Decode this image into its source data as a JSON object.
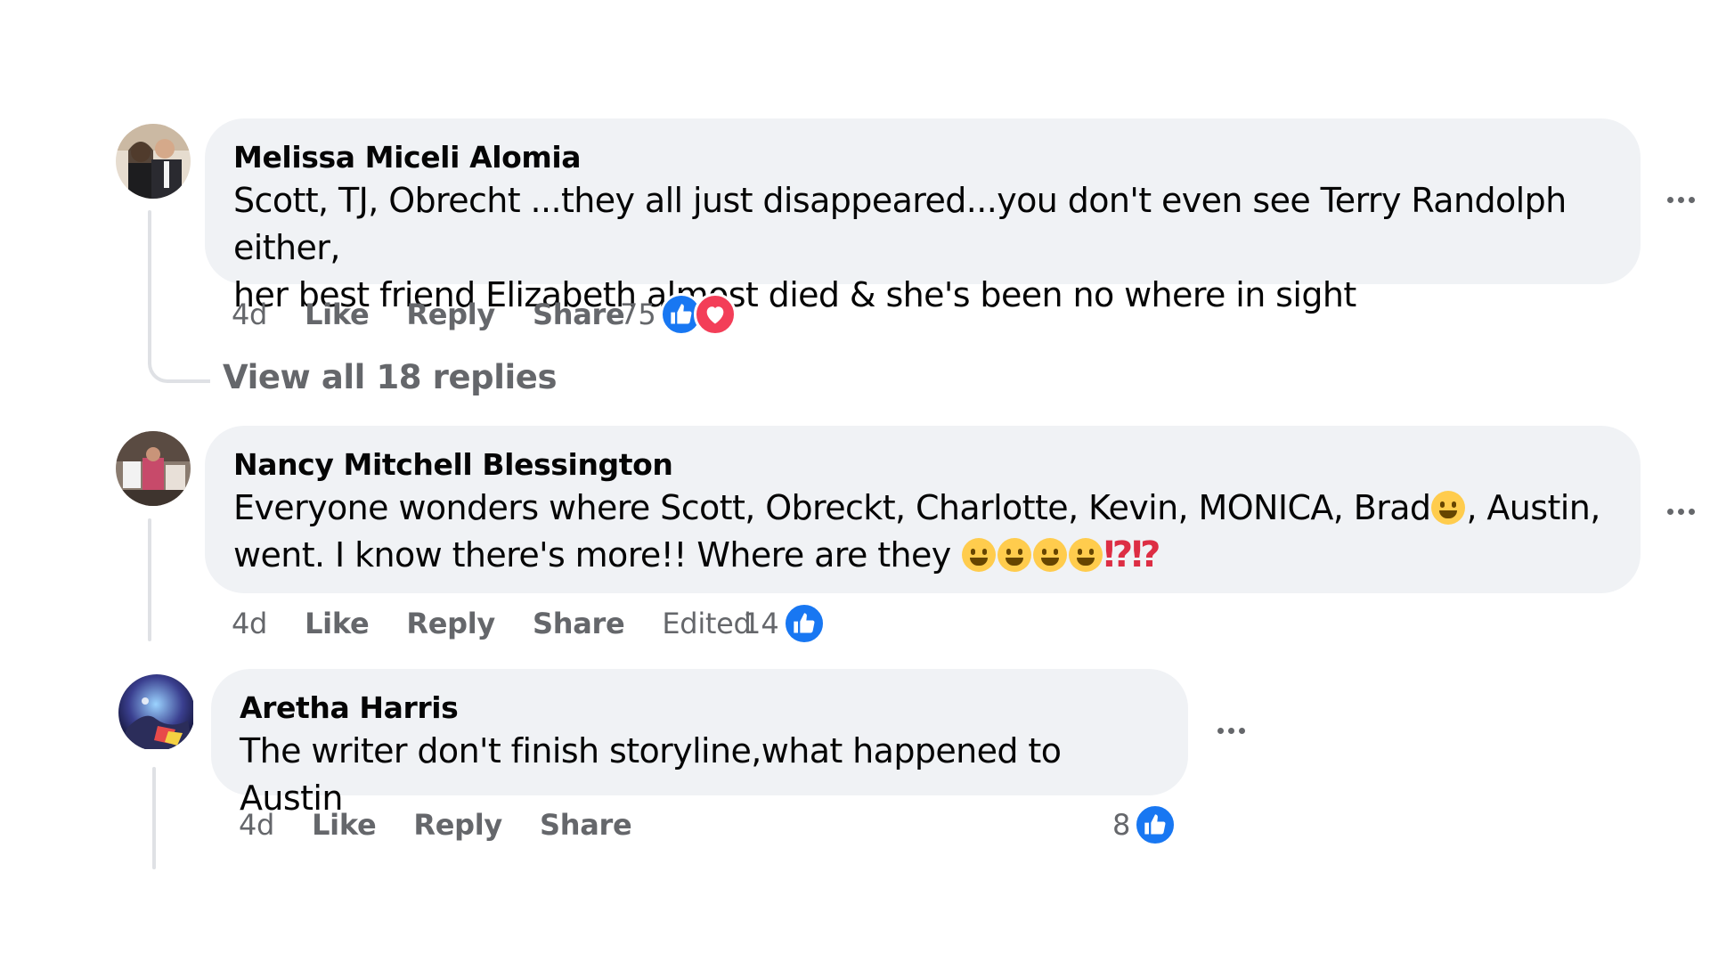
{
  "comments": [
    {
      "author": "Melissa Miceli Alomia",
      "text_line1": "Scott, TJ, Obrecht ...they all just disappeared...you don't even see Terry Randolph either,",
      "text_line2": "her best friend Elizabeth almost died & she's been no where in sight",
      "time": "4d",
      "like": "Like",
      "reply": "Reply",
      "share": "Share",
      "reaction_count": "75",
      "reactions": [
        "like-icon",
        "love-icon"
      ],
      "view_replies": "View all 18 replies"
    },
    {
      "author": "Nancy Mitchell Blessington",
      "text_line1_a": "Everyone wonders where Scott, Obreckt, Charlotte, Kevin, MONICA, Brad",
      "text_line1_b": ", Austin,",
      "text_line2": "went. I know there's more!! Where are they",
      "bangs": "⁉⁉",
      "time": "4d",
      "like": "Like",
      "reply": "Reply",
      "share": "Share",
      "edited": "Edited",
      "reaction_count": "14",
      "reactions": [
        "like-icon"
      ]
    },
    {
      "author": "Aretha Harris",
      "text": "The writer don't finish storyline,what happened to Austin",
      "time": "4d",
      "like": "Like",
      "reply": "Reply",
      "share": "Share",
      "reaction_count": "8",
      "reactions": [
        "like-icon"
      ]
    }
  ],
  "colors": {
    "bubble": "#f0f2f5",
    "secondary_text": "#65676b",
    "like_blue": "#1877f2",
    "love_red": "#f33e58",
    "thread_line": "#dfe1e5"
  }
}
